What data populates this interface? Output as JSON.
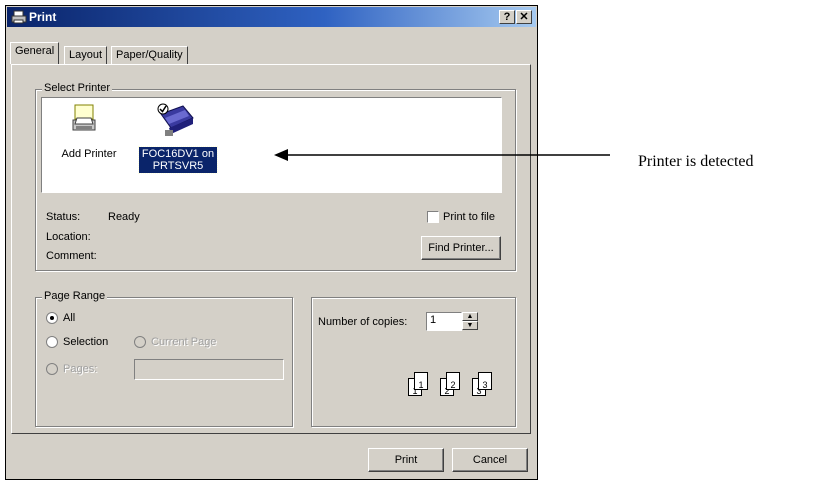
{
  "window": {
    "title": "Print",
    "help_label": "?",
    "close_label": "✕"
  },
  "tabs": [
    {
      "label": "General",
      "active": true
    },
    {
      "label": "Layout",
      "active": false
    },
    {
      "label": "Paper/Quality",
      "active": false
    }
  ],
  "select_printer": {
    "group_label": "Select Printer",
    "printers": [
      {
        "label": "Add Printer",
        "icon": "add-printer-icon",
        "selected": false
      },
      {
        "label": "FOC16DV1 on PRTSVR5",
        "icon": "network-printer-icon",
        "selected": true
      }
    ],
    "status_label": "Status:",
    "status_value": "Ready",
    "location_label": "Location:",
    "location_value": "",
    "comment_label": "Comment:",
    "comment_value": "",
    "print_to_file_label": "Print to file",
    "print_to_file_checked": false,
    "find_printer_label": "Find Printer..."
  },
  "page_range": {
    "group_label": "Page Range",
    "all_label": "All",
    "selection_label": "Selection",
    "current_page_label": "Current Page",
    "pages_label": "Pages:",
    "pages_value": "",
    "selected": "All"
  },
  "copies": {
    "label": "Number of copies:",
    "value": "1",
    "collate_pages": [
      "1",
      "1",
      "2",
      "2",
      "3",
      "3"
    ]
  },
  "buttons": {
    "print_label": "Print",
    "cancel_label": "Cancel"
  },
  "annotation": {
    "text": "Printer is detected"
  },
  "colors": {
    "face": "#d4d0c8",
    "title_start": "#0a246a",
    "title_end": "#a6caf0",
    "selection": "#0a246a"
  }
}
